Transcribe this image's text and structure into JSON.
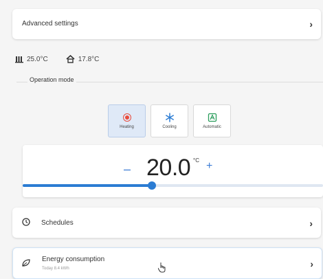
{
  "advanced": {
    "label": "Advanced settings"
  },
  "temps": {
    "current": "25.0°C",
    "outdoor": "17.8°C"
  },
  "operation": {
    "label": "Operation mode",
    "modes": [
      {
        "label": "Heating",
        "active": true
      },
      {
        "label": "Cooling",
        "active": false
      },
      {
        "label": "Automatic",
        "active": false
      }
    ]
  },
  "setpoint": {
    "value": "20.0",
    "unit": "°C",
    "minus": "–",
    "plus": "+",
    "slider_fraction": 0.43
  },
  "schedules": {
    "label": "Schedules"
  },
  "energy": {
    "label": "Energy consumption",
    "sub": "Today   8.4 kWh"
  },
  "colors": {
    "accent": "#2b7cd3",
    "heat": "#e94b3c",
    "active_bg": "#dfe9f7"
  },
  "icons": {
    "temp_indoor": "radiator-icon",
    "temp_outdoor": "house-icon",
    "heat": "sun-icon",
    "cool": "snowflake-icon",
    "auto": "auto-icon",
    "schedule": "clock-icon",
    "energy": "leaf-icon",
    "chevron": "chevron-right-icon"
  }
}
